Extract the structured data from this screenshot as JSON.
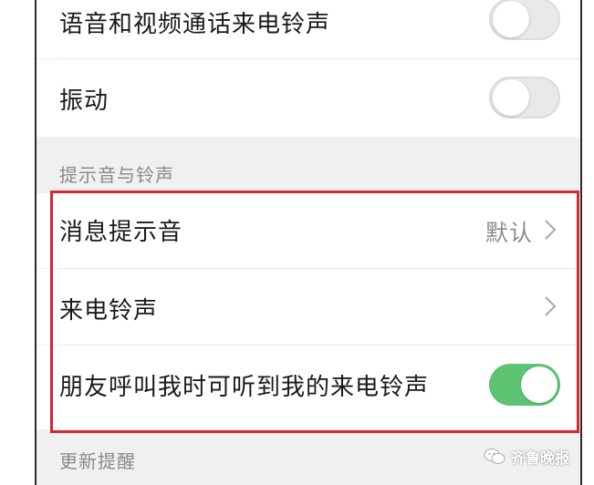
{
  "settings": {
    "call_ringtone_label": "语音和视频通话来电铃声",
    "call_ringtone_enabled": false,
    "vibrate_label": "振动",
    "vibrate_enabled": false,
    "sounds_section_title": "提示音与铃声",
    "message_tone_label": "消息提示音",
    "message_tone_value": "默认",
    "incoming_ringtone_label": "来电铃声",
    "friends_hear_ringtone_label": "朋友呼叫我时可听到我的来电铃声",
    "friends_hear_ringtone_enabled": true,
    "updates_section_title": "更新提醒"
  },
  "watermark": {
    "text": "齐鲁晚报",
    "icon": "wechat-channel-icon"
  },
  "colors": {
    "toggle_on": "#5fc374",
    "toggle_off": "#e9e9e9",
    "highlight_border": "#d7262e",
    "group_background": "#f0f0f0"
  }
}
